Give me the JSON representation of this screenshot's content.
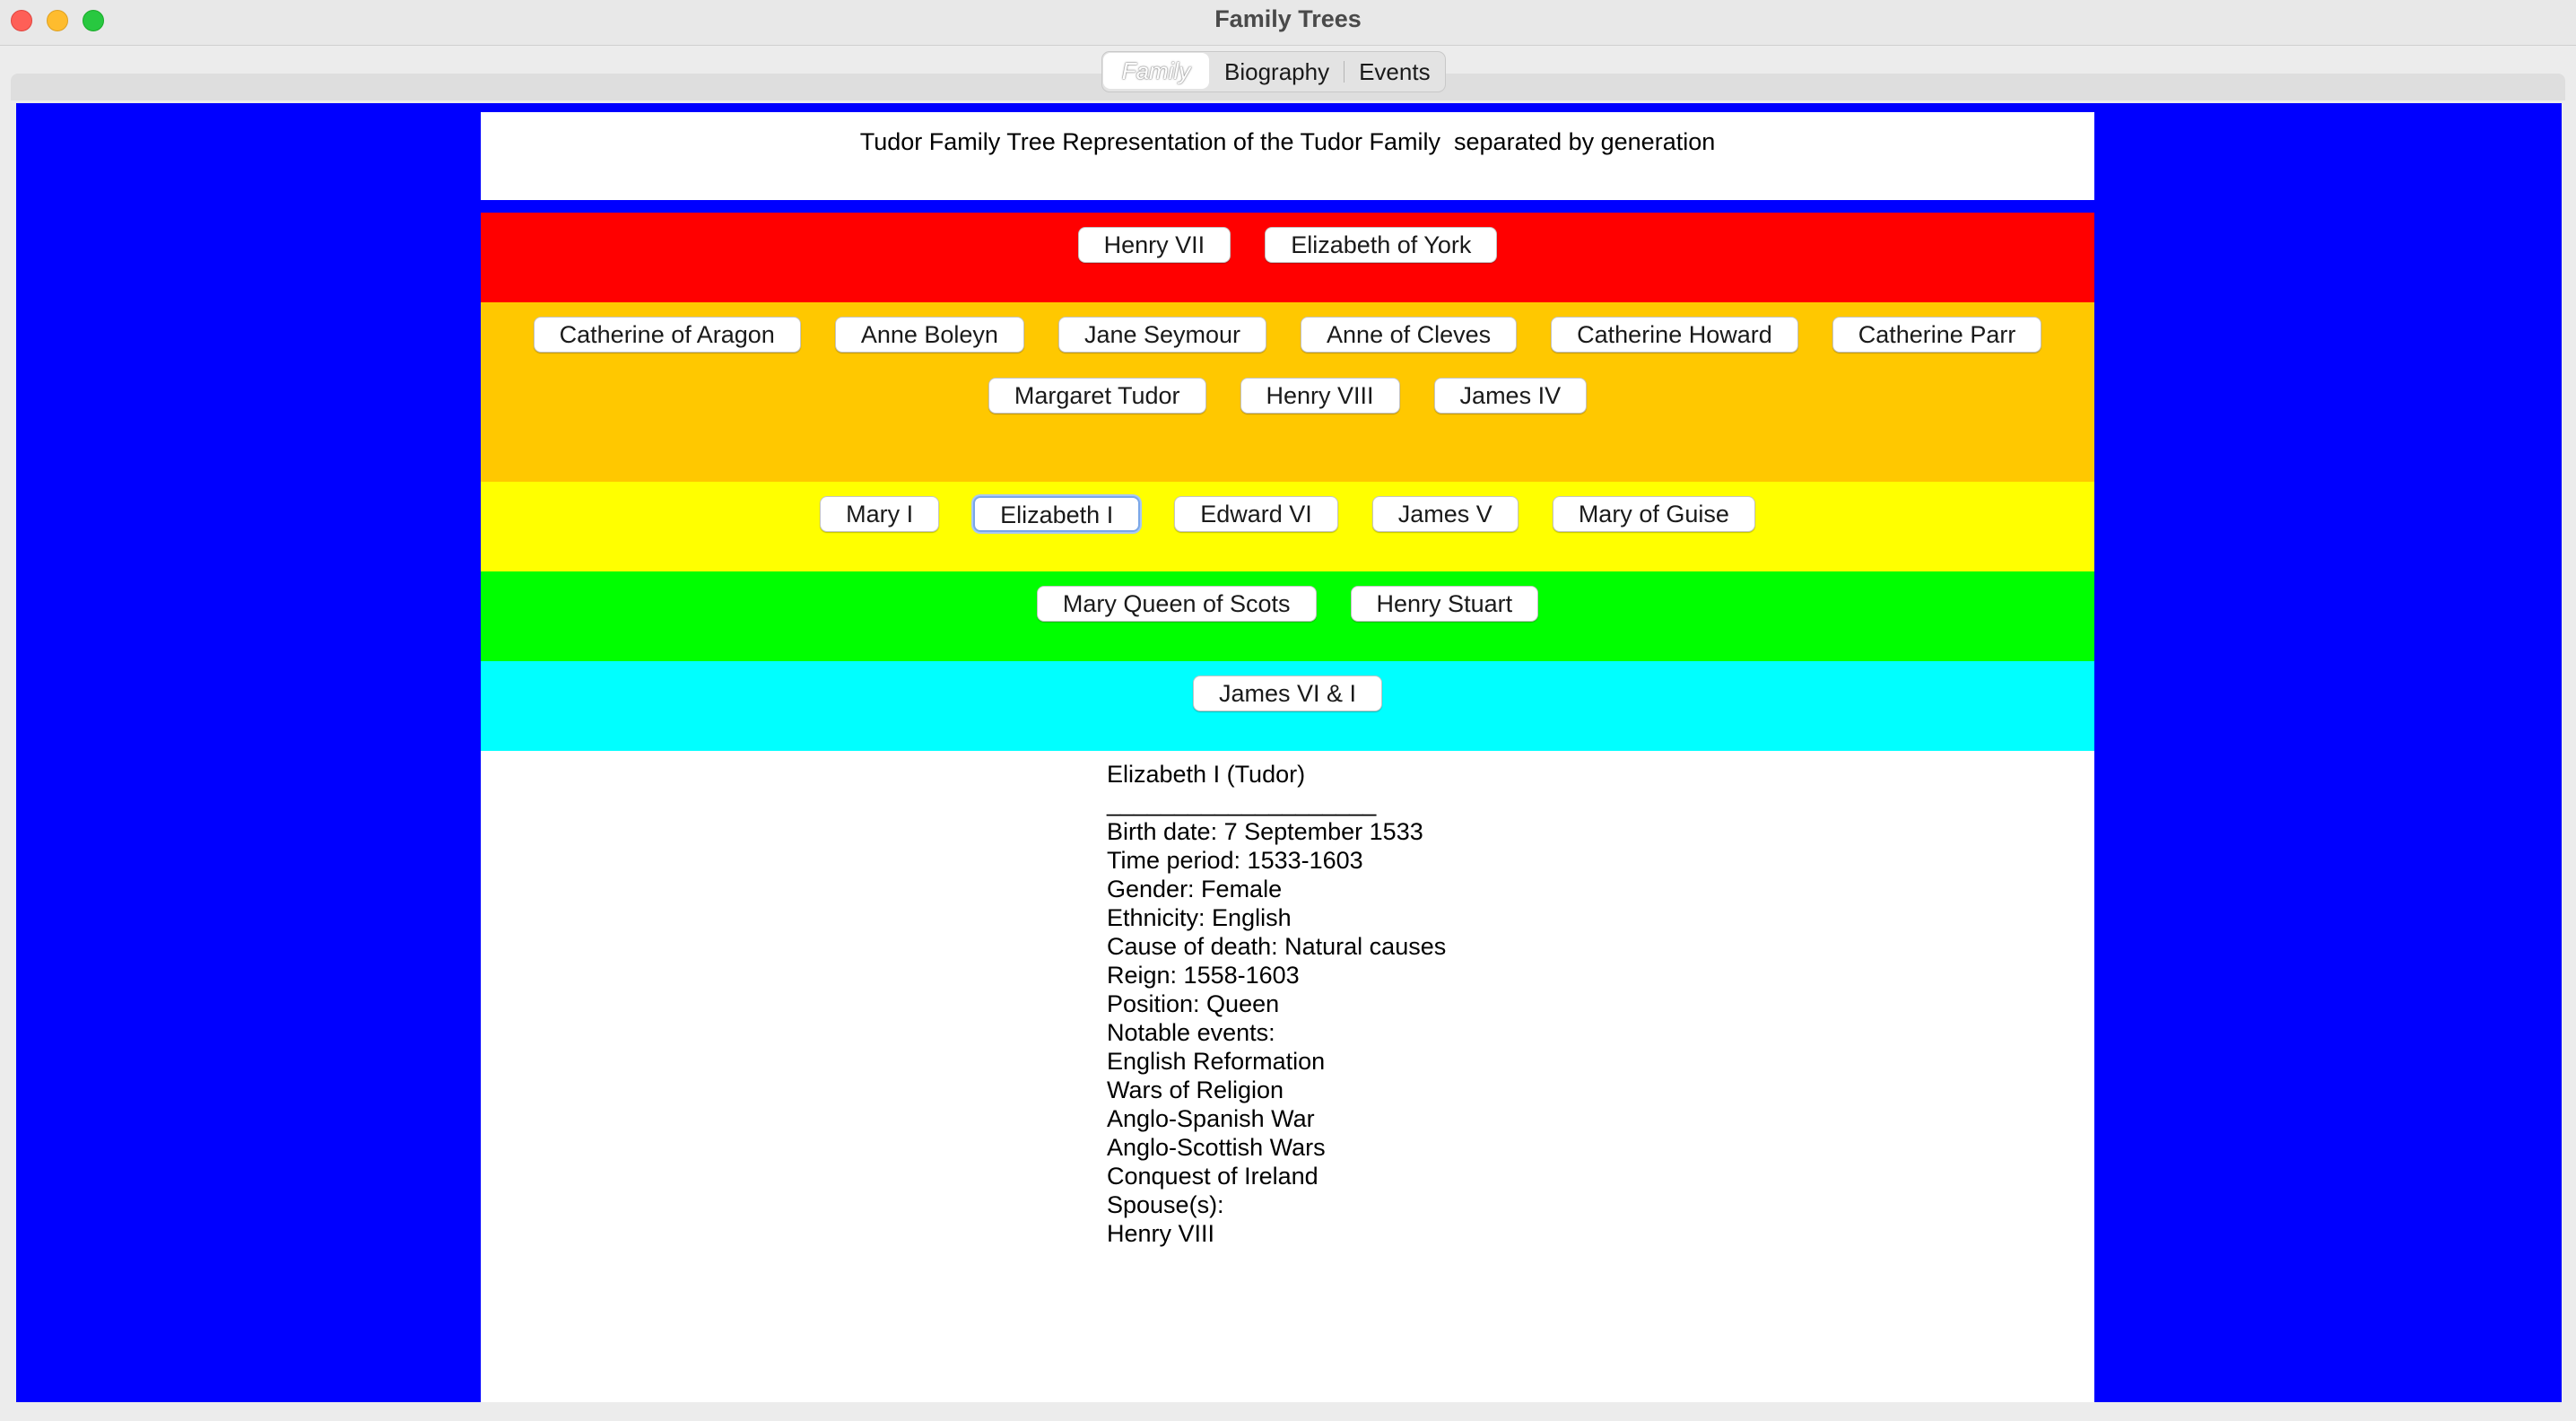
{
  "window": {
    "title": "Family Trees"
  },
  "tabs": [
    {
      "label": "Family",
      "selected": true
    },
    {
      "label": "Biography",
      "selected": false
    },
    {
      "label": "Events",
      "selected": false
    }
  ],
  "header": {
    "text": "Tudor Family Tree Representation of the Tudor Family  separated by generation"
  },
  "colors": {
    "background": "#0000ff",
    "generation_1": "#ff0000",
    "generation_2": "#ffc800",
    "generation_3": "#ffff00",
    "generation_4": "#00ff00",
    "generation_5": "#00ffff"
  },
  "generations": {
    "g1": [
      "Henry VII",
      "Elizabeth of York"
    ],
    "g2_row1": [
      "Catherine of Aragon",
      "Anne Boleyn",
      "Jane Seymour",
      "Anne of Cleves",
      "Catherine Howard",
      "Catherine Parr"
    ],
    "g2_row2": [
      "Margaret Tudor",
      "Henry VIII",
      "James IV"
    ],
    "g3": [
      "Mary I",
      "Elizabeth I",
      "Edward VI",
      "James V",
      "Mary of Guise"
    ],
    "g4": [
      "Mary Queen of Scots",
      "Henry Stuart"
    ],
    "g5": [
      "James VI & I"
    ]
  },
  "selected_person": "Elizabeth I",
  "biography": {
    "lines": [
      "Elizabeth I (Tudor)",
      "____________________",
      "Birth date: 7 September 1533",
      "Time period: 1533-1603",
      "Gender: Female",
      "Ethnicity: English",
      "Cause of death: Natural causes",
      "Reign: 1558-1603",
      "Position: Queen",
      "Notable events:",
      "English Reformation",
      "Wars of Religion",
      "Anglo-Spanish War",
      "Anglo-Scottish Wars",
      "Conquest of Ireland",
      "Spouse(s):",
      "Henry VIII"
    ]
  }
}
